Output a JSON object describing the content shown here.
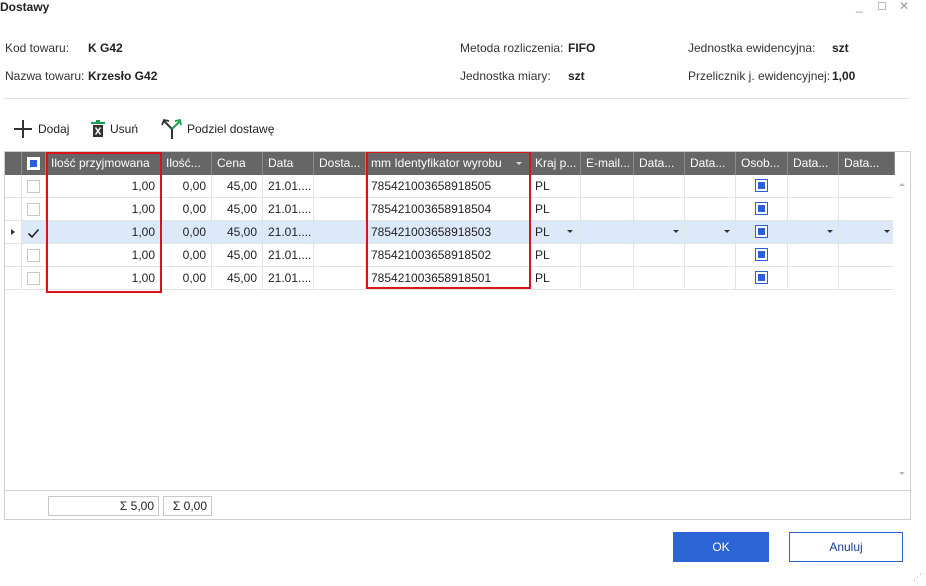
{
  "window": {
    "title": "Dostawy",
    "minimize": "_",
    "maximize": "☐",
    "close": "✕"
  },
  "info": {
    "kod_label": "Kod towaru:",
    "kod_value": "K G42",
    "nazwa_label": "Nazwa towaru:",
    "nazwa_value": "Krzesło G42",
    "metoda_label": "Metoda rozliczenia:",
    "metoda_value": "FIFO",
    "jm_label": "Jednostka miary:",
    "jm_value": "szt",
    "jed_ewid_label": "Jednostka ewidencyjna:",
    "jed_ewid_value": "szt",
    "przelicznik_label": "Przelicznik j. ewidencyjnej:",
    "przelicznik_value": "1,00"
  },
  "toolbar": {
    "add_label": "Dodaj",
    "delete_label": "Usuń",
    "split_label": "Podziel dostawę"
  },
  "grid": {
    "columns": [
      "Ilość przyjmowana",
      "Ilość...",
      "Cena",
      "Data",
      "Dosta...",
      "mm Identyfikator wyrobu",
      "Kraj p...",
      "E-mail...",
      "Data...",
      "Data...",
      "Osob...",
      "Data...",
      "Data..."
    ],
    "rows": [
      {
        "ilosc": "1,00",
        "ilosc2": "0,00",
        "cena": "45,00",
        "data": "21.01....",
        "dosta": "",
        "id": "785421003658918505",
        "kraj": "PL"
      },
      {
        "ilosc": "1,00",
        "ilosc2": "0,00",
        "cena": "45,00",
        "data": "21.01....",
        "dosta": "",
        "id": "785421003658918504",
        "kraj": "PL"
      },
      {
        "ilosc": "1,00",
        "ilosc2": "0,00",
        "cena": "45,00",
        "data": "21.01....",
        "dosta": "",
        "id": "785421003658918503",
        "kraj": "PL"
      },
      {
        "ilosc": "1,00",
        "ilosc2": "0,00",
        "cena": "45,00",
        "data": "21.01....",
        "dosta": "",
        "id": "785421003658918502",
        "kraj": "PL"
      },
      {
        "ilosc": "1,00",
        "ilosc2": "0,00",
        "cena": "45,00",
        "data": "21.01....",
        "dosta": "",
        "id": "785421003658918501",
        "kraj": "PL"
      }
    ],
    "selected_row_index": 2,
    "sum_ilosc": "Σ 5,00",
    "sum_ilosc2": "Σ 0,00"
  },
  "buttons": {
    "ok": "OK",
    "cancel": "Anuluj"
  },
  "colors": {
    "header_bg": "#666666",
    "selected_row_bg": "#dce9fb",
    "highlight_border": "#d9131b",
    "accent": "#2b64d4"
  }
}
